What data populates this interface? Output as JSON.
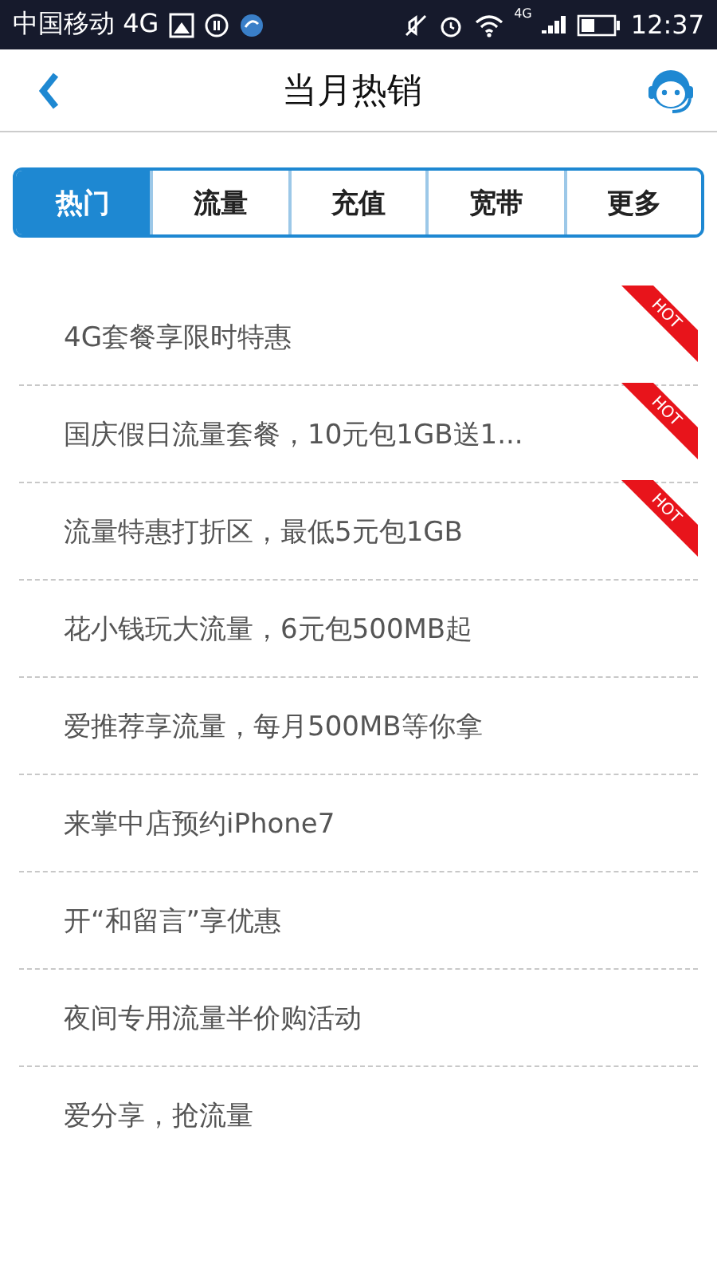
{
  "status_bar": {
    "carrier": "中国移动 4G",
    "network_badge": "4G",
    "time": "12:37"
  },
  "header": {
    "title": "当月热销"
  },
  "tabs": [
    {
      "label": "热门",
      "selected": true
    },
    {
      "label": "流量",
      "selected": false
    },
    {
      "label": "充值",
      "selected": false
    },
    {
      "label": "宽带",
      "selected": false
    },
    {
      "label": "更多",
      "selected": false
    }
  ],
  "items": [
    {
      "text": "4G套餐享限时特惠",
      "badge": "HOT"
    },
    {
      "text": "国庆假日流量套餐，10元包1GB送1...",
      "badge": "HOT"
    },
    {
      "text": "流量特惠打折区，最低5元包1GB",
      "badge": "HOT"
    },
    {
      "text": "花小钱玩大流量，6元包500MB起"
    },
    {
      "text": "爱推荐享流量，每月500MB等你拿"
    },
    {
      "text": "来掌中店预约iPhone7"
    },
    {
      "text": "开“和留言”享优惠"
    },
    {
      "text": "夜间专用流量半价购活动"
    },
    {
      "text": "爱分享，抢流量"
    }
  ]
}
